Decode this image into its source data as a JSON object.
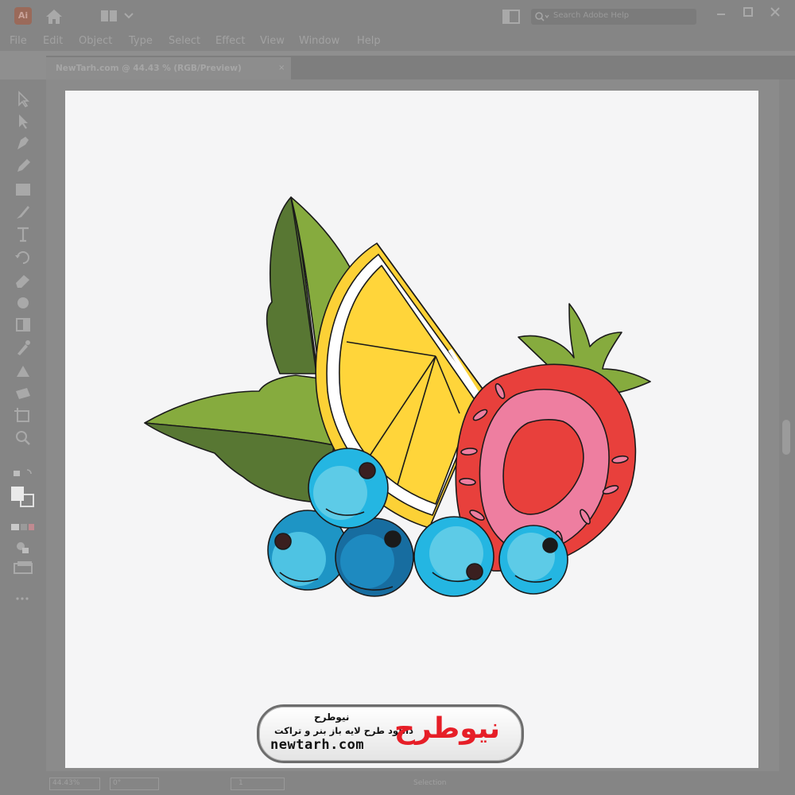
{
  "app": {
    "logo_text": "Ai",
    "search_placeholder": "Search Adobe Help"
  },
  "menu": [
    "File",
    "Edit",
    "Object",
    "Type",
    "Select",
    "Effect",
    "View",
    "Window",
    "Help"
  ],
  "document_tab": {
    "title": "NewTarh.com @ 44.43 % (RGB/Preview)",
    "close": "×"
  },
  "statusbar": {
    "zoom": "44.43%",
    "rotation": "0°",
    "artboard": "1",
    "mode": "Selection"
  },
  "watermark": {
    "title_fa": "نیوطرح",
    "subtitle_fa": "دانلود طرح لایه باز بنر و تراکت",
    "url": "newtarh.com",
    "logo_fa": "نیوطرح"
  },
  "colors": {
    "leaf_dark": "#587733",
    "leaf_light": "#86ab3e",
    "lemon_rind": "#fcd136",
    "lemon_flesh": "#ffd53a",
    "strawberry_red": "#e8403c",
    "strawberry_pink": "#ee7ea0",
    "blueberry_light": "#24b6e2",
    "blueberry_mid": "#1e95c5",
    "blueberry_dark": "#176da0",
    "brand_red": "#e61e27"
  }
}
